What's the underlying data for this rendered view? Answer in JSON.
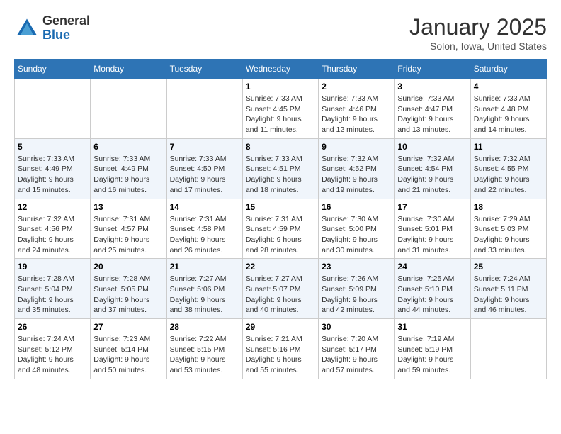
{
  "header": {
    "logo": {
      "general": "General",
      "blue": "Blue"
    },
    "title": "January 2025",
    "location": "Solon, Iowa, United States"
  },
  "calendar": {
    "days_of_week": [
      "Sunday",
      "Monday",
      "Tuesday",
      "Wednesday",
      "Thursday",
      "Friday",
      "Saturday"
    ],
    "weeks": [
      [
        {
          "day": "",
          "info": ""
        },
        {
          "day": "",
          "info": ""
        },
        {
          "day": "",
          "info": ""
        },
        {
          "day": "1",
          "info": "Sunrise: 7:33 AM\nSunset: 4:45 PM\nDaylight: 9 hours\nand 11 minutes."
        },
        {
          "day": "2",
          "info": "Sunrise: 7:33 AM\nSunset: 4:46 PM\nDaylight: 9 hours\nand 12 minutes."
        },
        {
          "day": "3",
          "info": "Sunrise: 7:33 AM\nSunset: 4:47 PM\nDaylight: 9 hours\nand 13 minutes."
        },
        {
          "day": "4",
          "info": "Sunrise: 7:33 AM\nSunset: 4:48 PM\nDaylight: 9 hours\nand 14 minutes."
        }
      ],
      [
        {
          "day": "5",
          "info": "Sunrise: 7:33 AM\nSunset: 4:49 PM\nDaylight: 9 hours\nand 15 minutes."
        },
        {
          "day": "6",
          "info": "Sunrise: 7:33 AM\nSunset: 4:49 PM\nDaylight: 9 hours\nand 16 minutes."
        },
        {
          "day": "7",
          "info": "Sunrise: 7:33 AM\nSunset: 4:50 PM\nDaylight: 9 hours\nand 17 minutes."
        },
        {
          "day": "8",
          "info": "Sunrise: 7:33 AM\nSunset: 4:51 PM\nDaylight: 9 hours\nand 18 minutes."
        },
        {
          "day": "9",
          "info": "Sunrise: 7:32 AM\nSunset: 4:52 PM\nDaylight: 9 hours\nand 19 minutes."
        },
        {
          "day": "10",
          "info": "Sunrise: 7:32 AM\nSunset: 4:54 PM\nDaylight: 9 hours\nand 21 minutes."
        },
        {
          "day": "11",
          "info": "Sunrise: 7:32 AM\nSunset: 4:55 PM\nDaylight: 9 hours\nand 22 minutes."
        }
      ],
      [
        {
          "day": "12",
          "info": "Sunrise: 7:32 AM\nSunset: 4:56 PM\nDaylight: 9 hours\nand 24 minutes."
        },
        {
          "day": "13",
          "info": "Sunrise: 7:31 AM\nSunset: 4:57 PM\nDaylight: 9 hours\nand 25 minutes."
        },
        {
          "day": "14",
          "info": "Sunrise: 7:31 AM\nSunset: 4:58 PM\nDaylight: 9 hours\nand 26 minutes."
        },
        {
          "day": "15",
          "info": "Sunrise: 7:31 AM\nSunset: 4:59 PM\nDaylight: 9 hours\nand 28 minutes."
        },
        {
          "day": "16",
          "info": "Sunrise: 7:30 AM\nSunset: 5:00 PM\nDaylight: 9 hours\nand 30 minutes."
        },
        {
          "day": "17",
          "info": "Sunrise: 7:30 AM\nSunset: 5:01 PM\nDaylight: 9 hours\nand 31 minutes."
        },
        {
          "day": "18",
          "info": "Sunrise: 7:29 AM\nSunset: 5:03 PM\nDaylight: 9 hours\nand 33 minutes."
        }
      ],
      [
        {
          "day": "19",
          "info": "Sunrise: 7:28 AM\nSunset: 5:04 PM\nDaylight: 9 hours\nand 35 minutes."
        },
        {
          "day": "20",
          "info": "Sunrise: 7:28 AM\nSunset: 5:05 PM\nDaylight: 9 hours\nand 37 minutes."
        },
        {
          "day": "21",
          "info": "Sunrise: 7:27 AM\nSunset: 5:06 PM\nDaylight: 9 hours\nand 38 minutes."
        },
        {
          "day": "22",
          "info": "Sunrise: 7:27 AM\nSunset: 5:07 PM\nDaylight: 9 hours\nand 40 minutes."
        },
        {
          "day": "23",
          "info": "Sunrise: 7:26 AM\nSunset: 5:09 PM\nDaylight: 9 hours\nand 42 minutes."
        },
        {
          "day": "24",
          "info": "Sunrise: 7:25 AM\nSunset: 5:10 PM\nDaylight: 9 hours\nand 44 minutes."
        },
        {
          "day": "25",
          "info": "Sunrise: 7:24 AM\nSunset: 5:11 PM\nDaylight: 9 hours\nand 46 minutes."
        }
      ],
      [
        {
          "day": "26",
          "info": "Sunrise: 7:24 AM\nSunset: 5:12 PM\nDaylight: 9 hours\nand 48 minutes."
        },
        {
          "day": "27",
          "info": "Sunrise: 7:23 AM\nSunset: 5:14 PM\nDaylight: 9 hours\nand 50 minutes."
        },
        {
          "day": "28",
          "info": "Sunrise: 7:22 AM\nSunset: 5:15 PM\nDaylight: 9 hours\nand 53 minutes."
        },
        {
          "day": "29",
          "info": "Sunrise: 7:21 AM\nSunset: 5:16 PM\nDaylight: 9 hours\nand 55 minutes."
        },
        {
          "day": "30",
          "info": "Sunrise: 7:20 AM\nSunset: 5:17 PM\nDaylight: 9 hours\nand 57 minutes."
        },
        {
          "day": "31",
          "info": "Sunrise: 7:19 AM\nSunset: 5:19 PM\nDaylight: 9 hours\nand 59 minutes."
        },
        {
          "day": "",
          "info": ""
        }
      ]
    ]
  }
}
